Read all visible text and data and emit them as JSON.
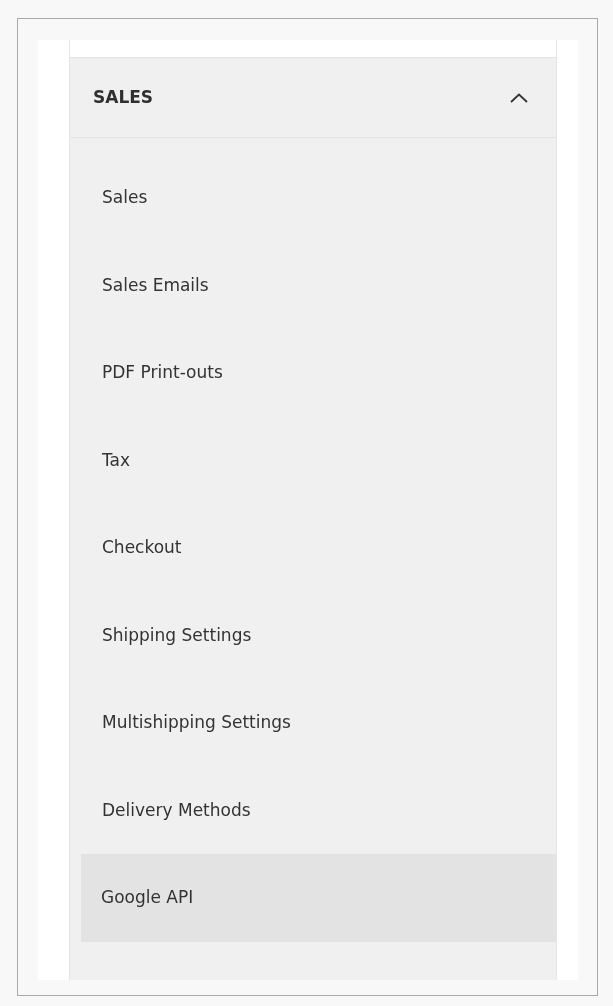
{
  "section": {
    "title": "SALES",
    "expanded": true,
    "items": [
      {
        "label": "Sales",
        "selected": false
      },
      {
        "label": "Sales Emails",
        "selected": false
      },
      {
        "label": "PDF Print-outs",
        "selected": false
      },
      {
        "label": "Tax",
        "selected": false
      },
      {
        "label": "Checkout",
        "selected": false
      },
      {
        "label": "Shipping Settings",
        "selected": false
      },
      {
        "label": "Multishipping Settings",
        "selected": false
      },
      {
        "label": "Delivery Methods",
        "selected": false
      },
      {
        "label": "Google API",
        "selected": true
      }
    ]
  }
}
